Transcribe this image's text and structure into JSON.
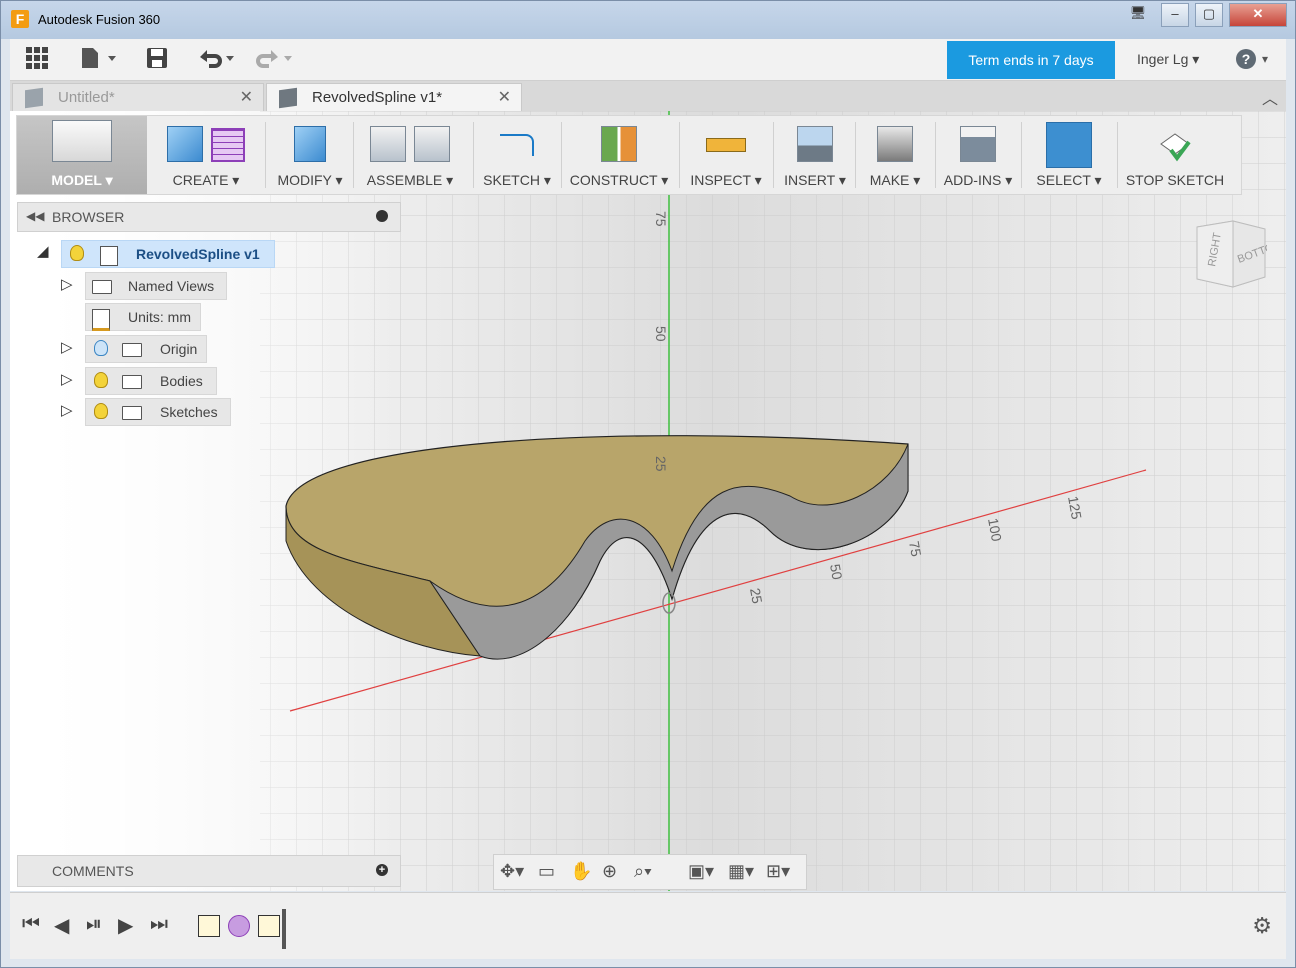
{
  "window": {
    "title": "Autodesk Fusion 360",
    "app_icon_letter": "F"
  },
  "toolbar": {
    "term_badge": "Term ends in 7 days",
    "user_name": "Inger Lg",
    "help_symbol": "?"
  },
  "tabs": [
    {
      "label": "Untitled*",
      "state": "inactive"
    },
    {
      "label": "RevolvedSpline v1*",
      "state": "active"
    }
  ],
  "ribbon": {
    "model": "MODEL ▾",
    "create": "CREATE ▾",
    "modify": "MODIFY ▾",
    "assemble": "ASSEMBLE ▾",
    "sketch": "SKETCH ▾",
    "construct": "CONSTRUCT ▾",
    "inspect": "INSPECT ▾",
    "insert": "INSERT ▾",
    "make": "MAKE ▾",
    "addins": "ADD-INS ▾",
    "select": "SELECT ▾",
    "stop_sketch": "STOP SKETCH"
  },
  "browser": {
    "title": "BROWSER",
    "root": "RevolvedSpline v1",
    "items": [
      {
        "label": "Named Views"
      },
      {
        "label": "Units: mm"
      },
      {
        "label": "Origin"
      },
      {
        "label": "Bodies"
      },
      {
        "label": "Sketches"
      }
    ]
  },
  "viewport": {
    "axis_labels_vertical": [
      "75",
      "50",
      "25"
    ],
    "axis_labels_horizontal": [
      "25",
      "50",
      "75",
      "100",
      "125"
    ],
    "viewcube_faces": [
      "RIGHT",
      "BOTTOM"
    ]
  },
  "comments": {
    "title": "COMMENTS"
  },
  "colors": {
    "accent_blue": "#1b9ae0",
    "body_tan": "#b8a56a",
    "body_cut_gray": "#9a9a9a",
    "x_axis_red": "#e04040",
    "y_axis_green": "#3fbf3f"
  }
}
